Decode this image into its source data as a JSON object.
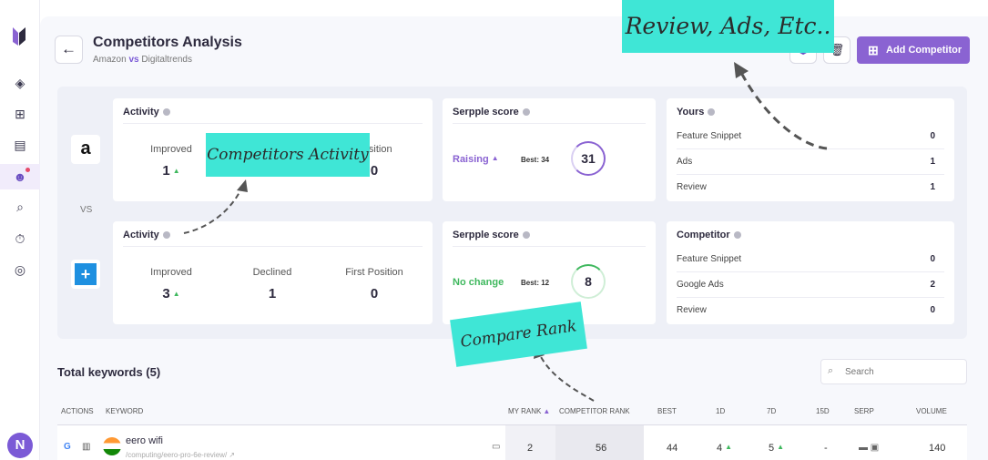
{
  "sidebar": {
    "icons": [
      "logo-icon",
      "layers-icon",
      "grid-icon",
      "chart-icon",
      "robot-icon",
      "search-icon",
      "timer-icon",
      "settings-icon"
    ],
    "avatar": "N",
    "accent": "#8a63d2"
  },
  "header": {
    "title": "Competitors Analysis",
    "sub_left": "Amazon",
    "sub_vs": "vs",
    "sub_right": "Digitaltrends",
    "add_label": "Add Competitor"
  },
  "top": {
    "activity": {
      "title": "Activity",
      "improved_label": "Improved",
      "improved": "1",
      "position_label": "Position",
      "position": "0"
    },
    "serpple": {
      "title": "Serpple score",
      "trend": "Raising",
      "best": "Best: 34",
      "score": "31"
    },
    "yours": {
      "title": "Yours",
      "rows": [
        {
          "label": "Feature Snippet",
          "value": "0"
        },
        {
          "label": "Ads",
          "value": "1"
        },
        {
          "label": "Review",
          "value": "1"
        }
      ]
    }
  },
  "vs": "VS",
  "bottom": {
    "activity": {
      "title": "Activity",
      "improved_label": "Improved",
      "improved": "3",
      "declined_label": "Declined",
      "declined": "1",
      "first_label": "First Position",
      "first": "0"
    },
    "serpple": {
      "title": "Serpple score",
      "trend": "No change",
      "best": "Best: 12",
      "score": "8"
    },
    "competitor": {
      "title": "Competitor",
      "rows": [
        {
          "label": "Feature Snippet",
          "value": "0"
        },
        {
          "label": "Google Ads",
          "value": "2"
        },
        {
          "label": "Review",
          "value": "0"
        }
      ]
    }
  },
  "keywords": {
    "title": "Total keywords (5)",
    "search_placeholder": "Search",
    "headers": {
      "actions": "ACTIONS",
      "keyword": "KEYWORD",
      "my_rank": "MY RANK",
      "competitor_rank": "COMPETITOR RANK",
      "best": "BEST",
      "one_d": "1D",
      "seven_d": "7D",
      "fifteen_d": "15D",
      "serp": "SERP",
      "volume": "VOLUME"
    },
    "rows": [
      {
        "keyword": "eero wifi",
        "url": "/computing/eero-pro-6e-review/",
        "my_rank": "2",
        "competitor_rank": "56",
        "best": "44",
        "one_d": "4",
        "seven_d": "5",
        "fifteen_d": "-",
        "volume": "140"
      }
    ]
  },
  "callouts": {
    "review": "Review, Ads, Etc..",
    "activity": "Competitors Activity",
    "rank": "Compare Rank"
  }
}
